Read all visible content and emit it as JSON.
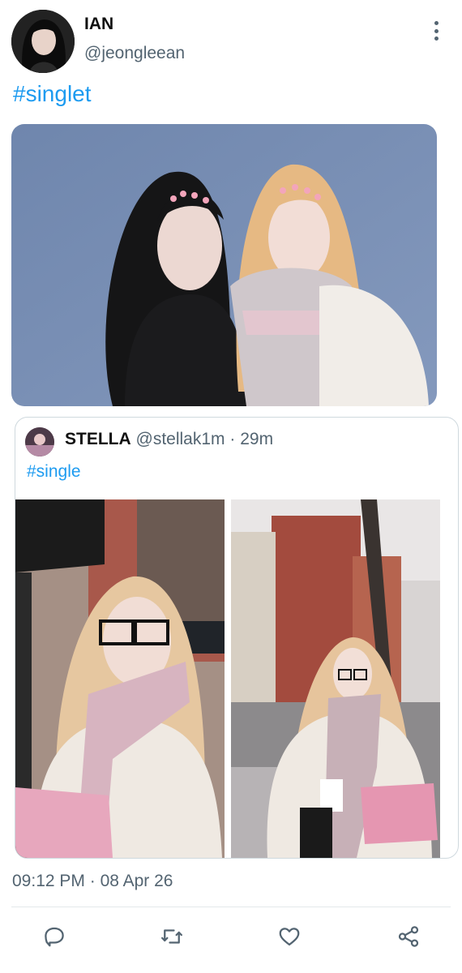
{
  "author": {
    "display_name": "IAN",
    "handle": "@jeongleean",
    "avatar_icon": "avatar-photo"
  },
  "menu_icon": "more-vertical-icon",
  "tweet": {
    "text": "#singlet",
    "timestamp": "09:12 PM",
    "date": "08 Apr 26",
    "separator": "·"
  },
  "quote": {
    "display_name": "STELLA",
    "handle": "@stellak1m",
    "separator": "·",
    "time_ago": "29m",
    "text": "#single",
    "images": [
      "street-photo-1",
      "street-photo-2"
    ]
  },
  "actions": [
    {
      "name": "reply",
      "icon": "reply-icon"
    },
    {
      "name": "retweet",
      "icon": "retweet-icon"
    },
    {
      "name": "like",
      "icon": "heart-icon"
    },
    {
      "name": "share",
      "icon": "share-icon"
    }
  ],
  "colors": {
    "link": "#1d9bf0",
    "secondary_text": "#536471",
    "border": "#cfd9de"
  }
}
